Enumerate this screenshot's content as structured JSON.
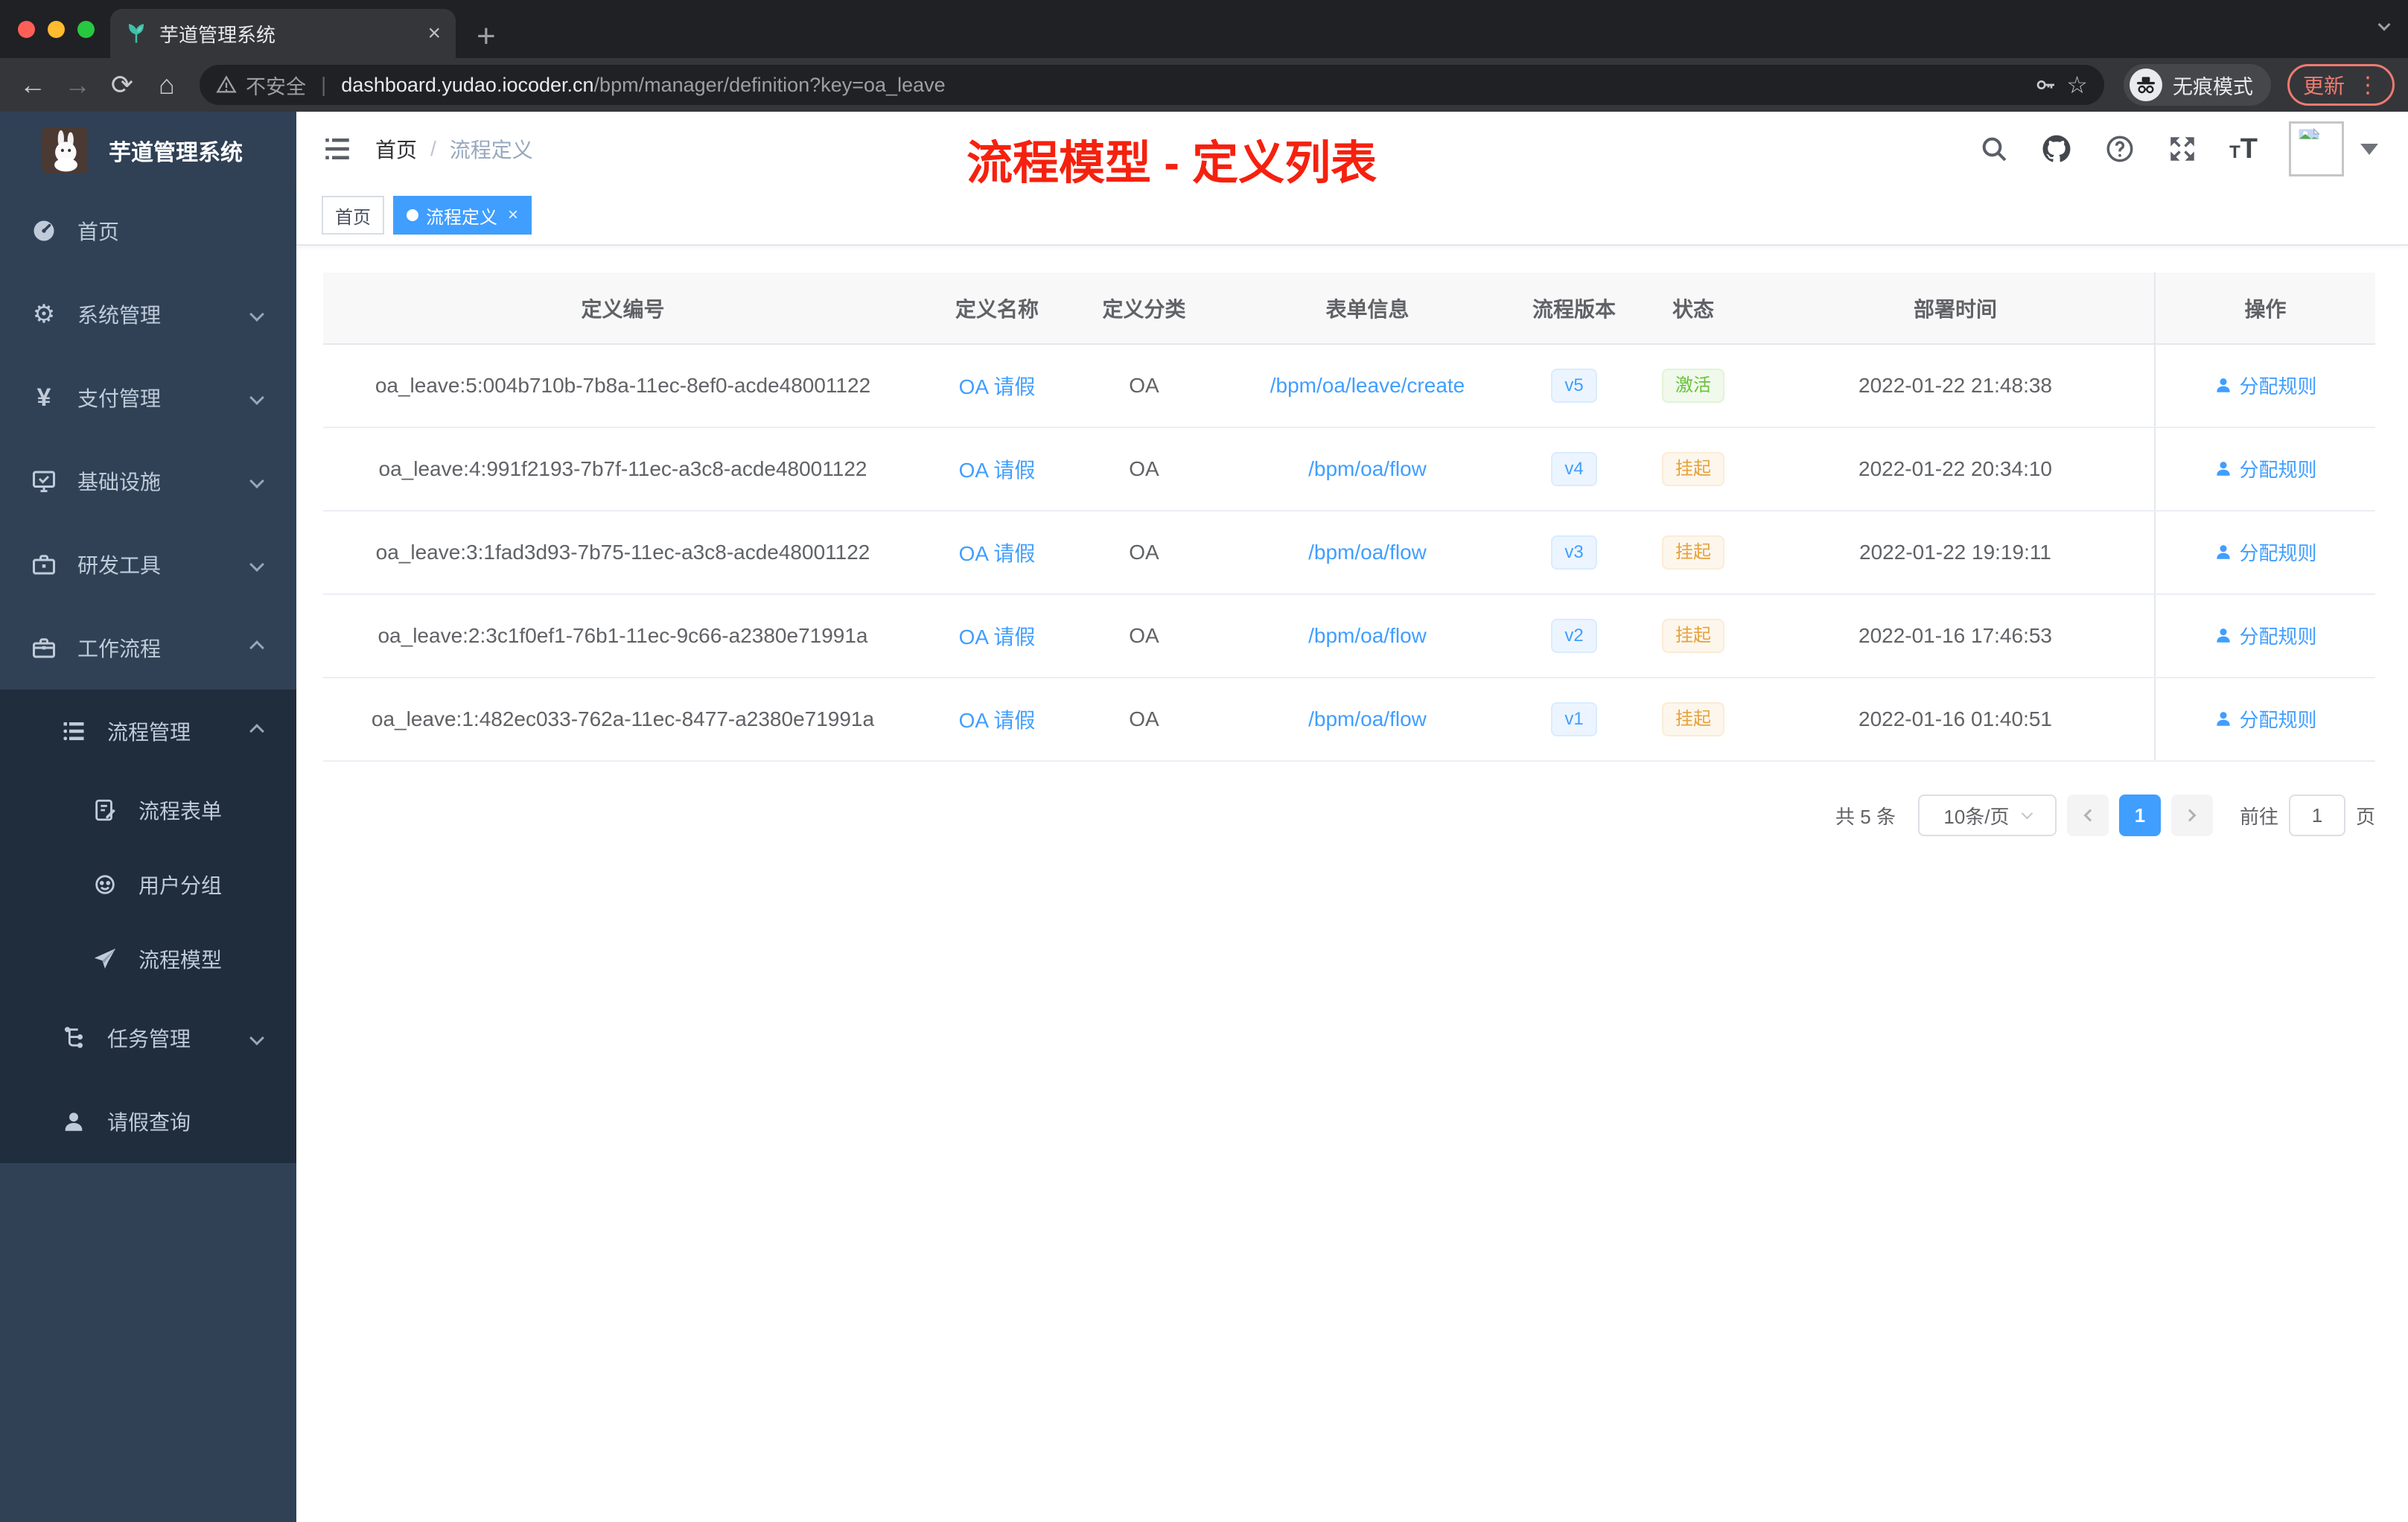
{
  "colors": {
    "accent": "#409eff",
    "link": "#409eff",
    "status_active": "#67c23a",
    "status_suspended": "#e6a23c",
    "annotation_red": "#f5210f",
    "sidebar_bg": "#304156",
    "submenu_bg": "#1f2d3d"
  },
  "browser": {
    "tab_title": "芋道管理系统",
    "new_tab": "+",
    "security_label": "不安全",
    "url_host": "dashboard.yudao.iocoder.cn",
    "url_path": "/bpm/manager/definition?key=oa_leave",
    "incognito_label": "无痕模式",
    "update_label": "更新"
  },
  "sidebar": {
    "logo_title": "芋道管理系统",
    "items": [
      {
        "label": "首页"
      },
      {
        "label": "系统管理"
      },
      {
        "label": "支付管理"
      },
      {
        "label": "基础设施"
      },
      {
        "label": "研发工具"
      },
      {
        "label": "工作流程"
      },
      {
        "label": "流程管理"
      },
      {
        "label": "流程表单"
      },
      {
        "label": "用户分组"
      },
      {
        "label": "流程模型"
      },
      {
        "label": "任务管理"
      },
      {
        "label": "请假查询"
      }
    ]
  },
  "header": {
    "breadcrumb": [
      "首页",
      "流程定义"
    ],
    "annotation": "流程模型 - 定义列表"
  },
  "tags": {
    "home": "首页",
    "active": "流程定义",
    "close": "×"
  },
  "table": {
    "columns": [
      "定义编号",
      "定义名称",
      "定义分类",
      "表单信息",
      "流程版本",
      "状态",
      "部署时间",
      "操作"
    ],
    "rows": [
      {
        "id": "oa_leave:5:004b710b-7b8a-11ec-8ef0-acde48001122",
        "name": "OA 请假",
        "category": "OA",
        "form": "/bpm/oa/leave/create",
        "version": "v5",
        "status": "激活",
        "status_type": "active",
        "deploy_time": "2022-01-22 21:48:38",
        "action": "分配规则"
      },
      {
        "id": "oa_leave:4:991f2193-7b7f-11ec-a3c8-acde48001122",
        "name": "OA 请假",
        "category": "OA",
        "form": "/bpm/oa/flow",
        "version": "v4",
        "status": "挂起",
        "status_type": "suspended",
        "deploy_time": "2022-01-22 20:34:10",
        "action": "分配规则"
      },
      {
        "id": "oa_leave:3:1fad3d93-7b75-11ec-a3c8-acde48001122",
        "name": "OA 请假",
        "category": "OA",
        "form": "/bpm/oa/flow",
        "version": "v3",
        "status": "挂起",
        "status_type": "suspended",
        "deploy_time": "2022-01-22 19:19:11",
        "action": "分配规则"
      },
      {
        "id": "oa_leave:2:3c1f0ef1-76b1-11ec-9c66-a2380e71991a",
        "name": "OA 请假",
        "category": "OA",
        "form": "/bpm/oa/flow",
        "version": "v2",
        "status": "挂起",
        "status_type": "suspended",
        "deploy_time": "2022-01-16 17:46:53",
        "action": "分配规则"
      },
      {
        "id": "oa_leave:1:482ec033-762a-11ec-8477-a2380e71991a",
        "name": "OA 请假",
        "category": "OA",
        "form": "/bpm/oa/flow",
        "version": "v1",
        "status": "挂起",
        "status_type": "suspended",
        "deploy_time": "2022-01-16 01:40:51",
        "action": "分配规则"
      }
    ]
  },
  "pagination": {
    "total": "共 5 条",
    "page_size": "10条/页",
    "current_page": "1",
    "goto_label": "前往",
    "goto_value": "1",
    "page_unit": "页"
  }
}
